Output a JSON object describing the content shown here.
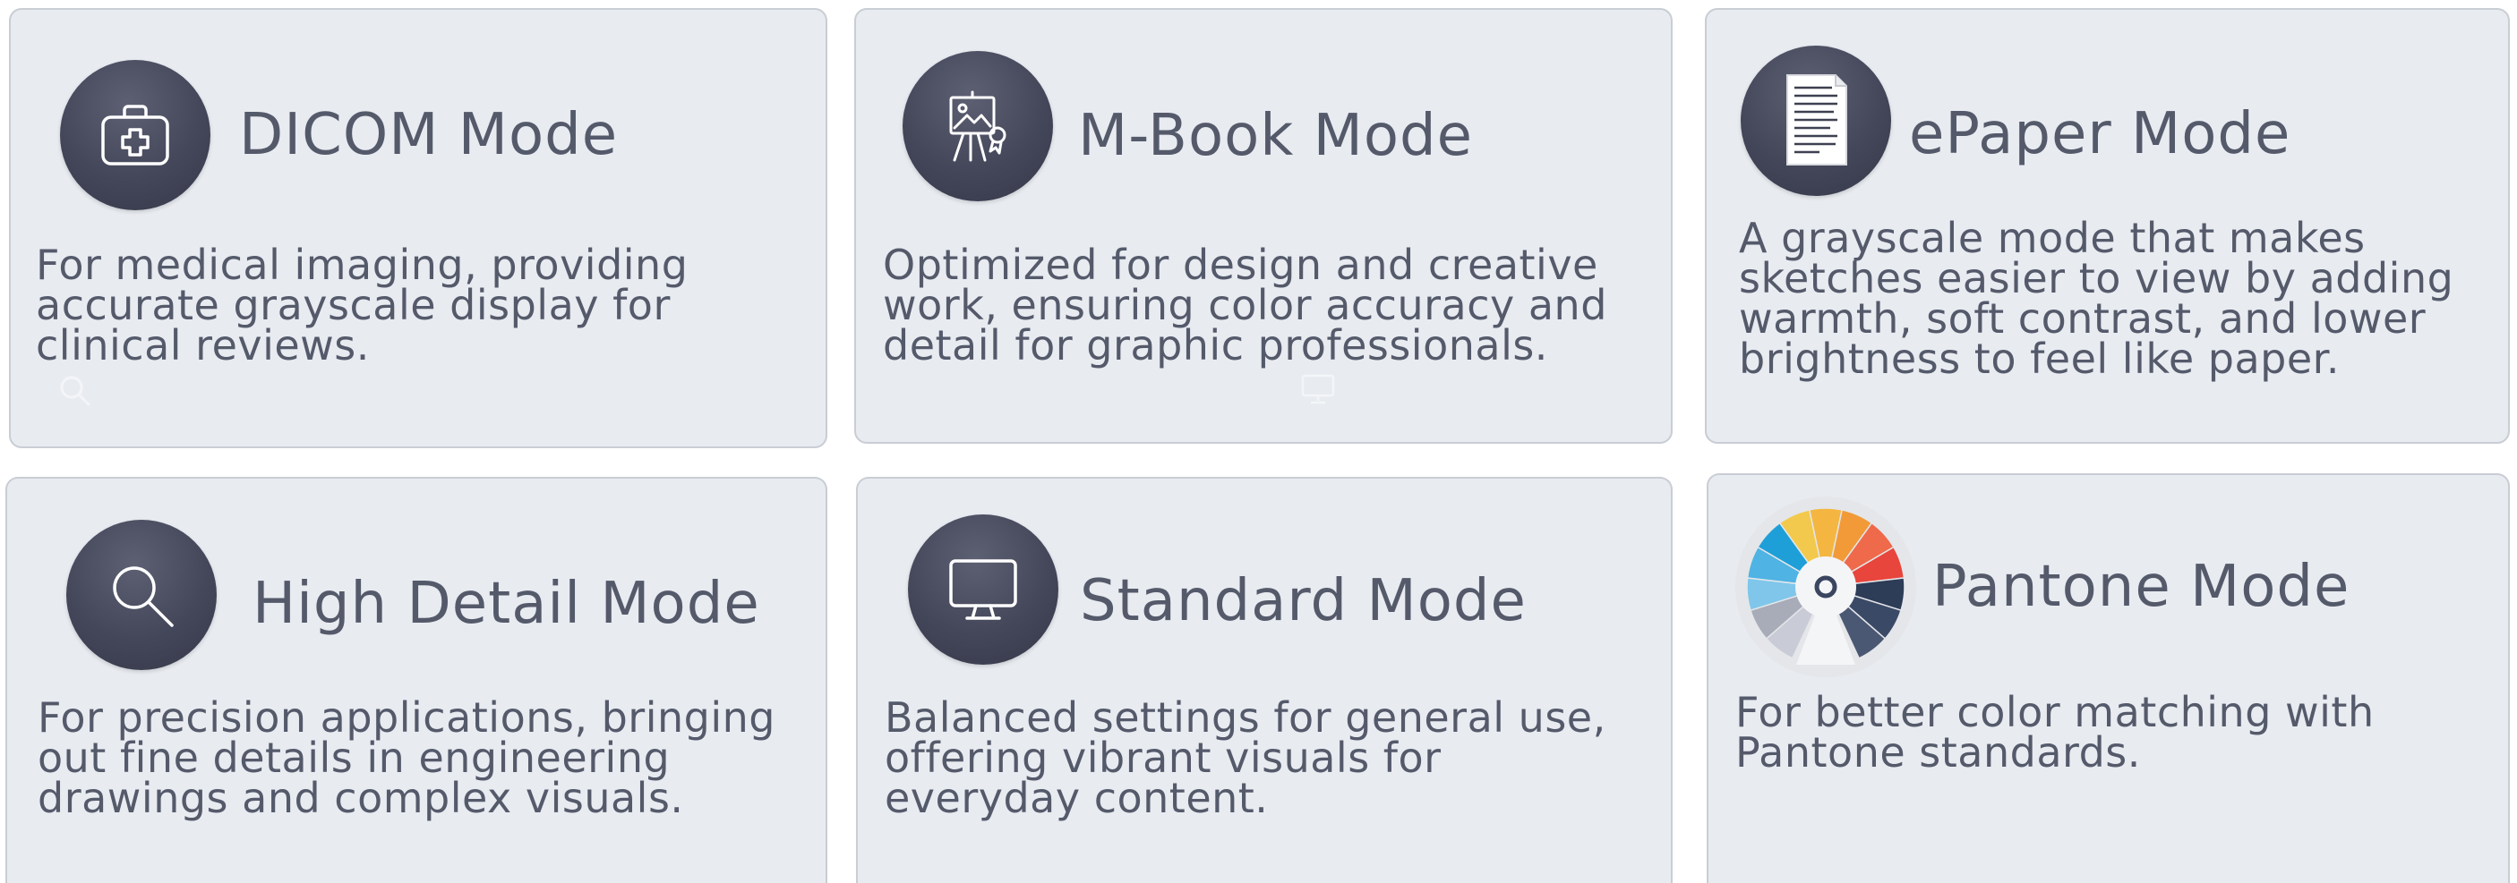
{
  "cards": [
    {
      "title": "DICOM Mode",
      "description": "For medical imaging, providing accurate grayscale display for clinical reviews.",
      "icon": "medical-kit-icon"
    },
    {
      "title": "M-Book Mode",
      "description": "Optimized for design and creative work, ensuring color accuracy and detail for graphic professionals.",
      "icon": "easel-icon"
    },
    {
      "title": "ePaper Mode",
      "description": "A grayscale mode that makes sketches easier to view by adding warmth, soft contrast, and lower brightness to feel like paper.",
      "icon": "document-icon"
    },
    {
      "title": "High Detail Mode",
      "description": "For precision applications, bringing out fine details in engineering drawings and complex visuals.",
      "icon": "magnifier-icon"
    },
    {
      "title": "Standard Mode",
      "description": "Balanced settings for general use, offering vibrant visuals for everyday content.",
      "icon": "monitor-icon"
    },
    {
      "title": "Pantone Mode",
      "description": "For better color matching with Pantone standards.",
      "icon": "color-wheel-icon"
    }
  ],
  "colors": {
    "card_bg": "#e8ebf0",
    "card_border": "#c9cdd4",
    "text": "#555a6b",
    "icon_bg": "#44475a"
  }
}
